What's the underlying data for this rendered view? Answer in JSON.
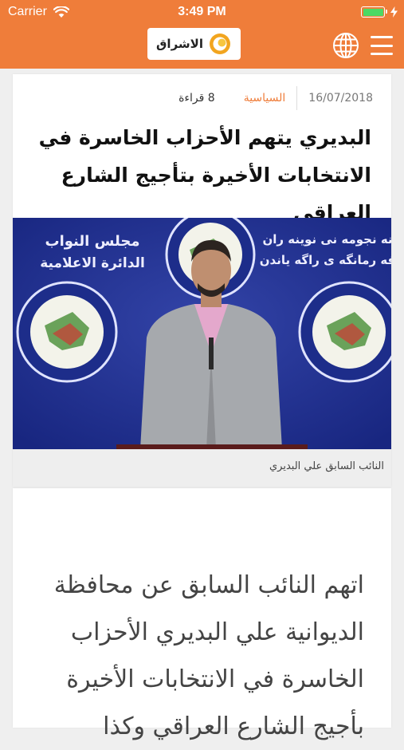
{
  "status_bar": {
    "carrier": "Carrier",
    "time": "3:49 PM",
    "battery_level": 1.0,
    "battery_color": "#4cd964"
  },
  "header": {
    "logo_text": "الاشراق",
    "background": "#ef7d3a",
    "icons": [
      "globe-icon",
      "hamburger-menu-icon"
    ]
  },
  "article": {
    "date": "16/07/2018",
    "category": "السياسية",
    "reads": "8 قراءة",
    "headline": "البديري يتهم الأحزاب الخاسرة في الانتخابات الأخيرة بتأجيج الشارع العراقي",
    "photo_caption": "النائب السابق علي البديري",
    "photo_banner_left": "مجلس النواب",
    "photo_banner_left_sub": "الدائرة الاعلامية",
    "photo_banner_right": "نه نجومه نى نوينه ران",
    "photo_banner_right_sub": "فه رمانگه ى راگه ياندن",
    "body": "اتهم النائب السابق عن محافظة الديوانية علي البديري الأحزاب الخاسرة في الانتخابات الأخيرة بأجيج الشارع العراقي وكذا"
  }
}
